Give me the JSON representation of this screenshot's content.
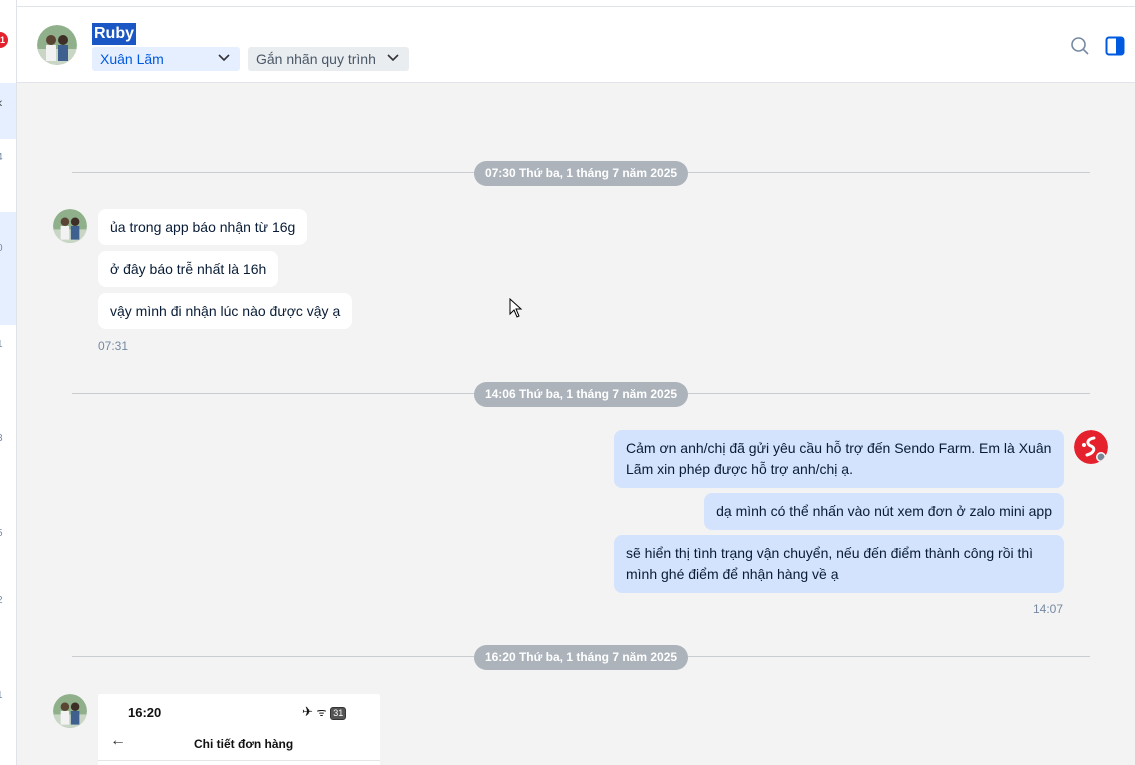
{
  "sidebar_strip": {
    "unread_badge": "1",
    "numbers": [
      "4",
      "0",
      "1",
      "3",
      "5",
      "2",
      "1"
    ]
  },
  "header": {
    "contact_name": "Ruby",
    "assignee": "Xuân Lãm",
    "tag_label": "Gắn nhãn quy trình",
    "icons": [
      "search-icon",
      "side-panel-icon"
    ]
  },
  "messages": {
    "sep1": "07:30 Thứ ba, 1 tháng 7 năm 2025",
    "in1": "ủa trong app báo nhận từ 16g",
    "in2": "ở đây báo trễ nhất là 16h",
    "in3": "vậy mình đi nhận lúc nào được vậy ạ",
    "time1": "07:31",
    "sep2": "14:06 Thứ ba, 1 tháng 7 năm 2025",
    "out1_line1": "Cảm ơn anh/chị đã gửi yêu cầu hỗ trợ đến Sendo Farm. Em là Xuân",
    "out1_line2": "Lãm xin phép được hỗ trợ anh/chị ạ.",
    "out2": "dạ mình có thể nhấn vào nút xem đơn ở zalo mini app",
    "out3_line1": "sẽ hiển thị tình trạng vận chuyển, nếu đến điểm thành công rồi thì",
    "out3_line2": "mình ghé điểm để nhận hàng về ạ",
    "time2": "14:07",
    "sep3": "16:20 Thứ ba, 1 tháng 7 năm 2025"
  },
  "image_preview": {
    "status_time": "16:20",
    "status_battery": "31",
    "screen_title": "Chi tiết đơn hàng"
  },
  "colors": {
    "accent": "#005ae0",
    "out_bubble": "#d3e3fe",
    "chat_bg": "#f3f3f3",
    "sep_pill": "#acb3bb",
    "brand_red": "#e5212d"
  }
}
